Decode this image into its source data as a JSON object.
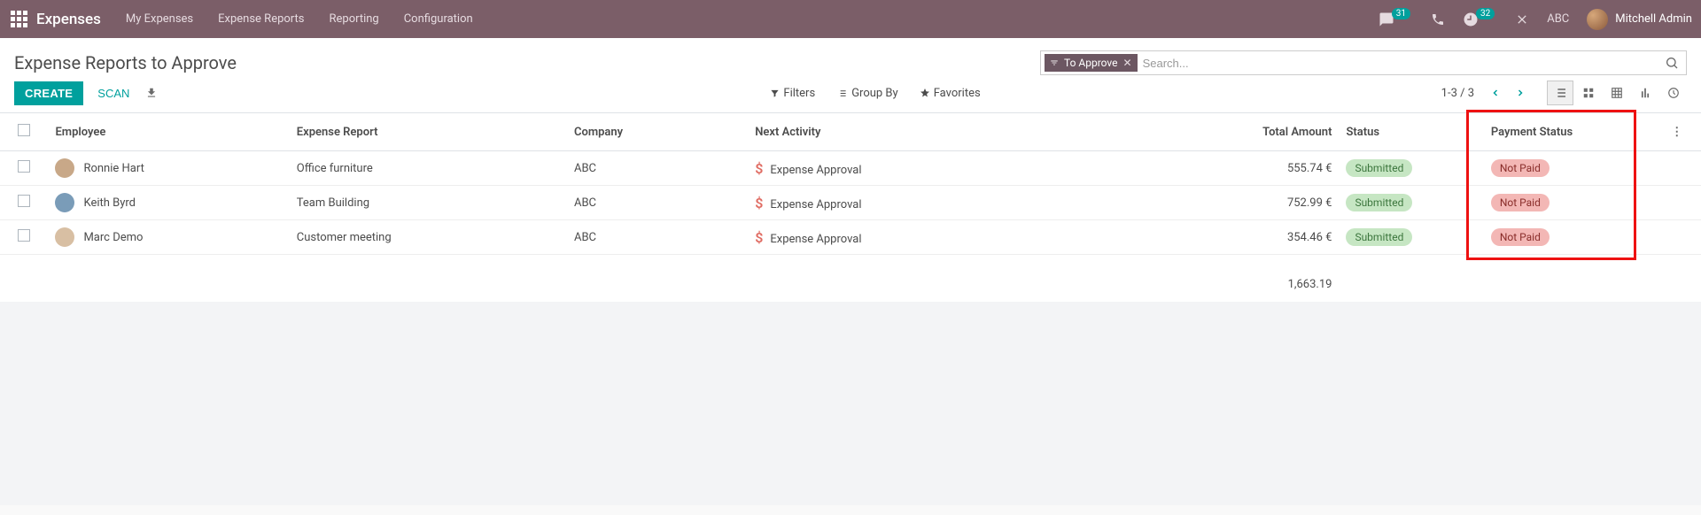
{
  "brand": "Expenses",
  "nav": [
    "My Expenses",
    "Expense Reports",
    "Reporting",
    "Configuration"
  ],
  "badges": {
    "chat": "31",
    "clock": "32"
  },
  "company": "ABC",
  "user": "Mitchell Admin",
  "page_title": "Expense Reports to Approve",
  "filter_chip": "To Approve",
  "search_placeholder": "Search...",
  "btn_create": "CREATE",
  "btn_scan": "SCAN",
  "toolbar": {
    "filters": "Filters",
    "groupby": "Group By",
    "favorites": "Favorites"
  },
  "pager": "1-3 / 3",
  "columns": {
    "employee": "Employee",
    "report": "Expense Report",
    "company": "Company",
    "activity": "Next Activity",
    "amount": "Total Amount",
    "status": "Status",
    "payment": "Payment Status"
  },
  "rows": [
    {
      "employee": "Ronnie Hart",
      "report": "Office furniture",
      "company": "ABC",
      "activity": "Expense Approval",
      "amount": "555.74 €",
      "status": "Submitted",
      "payment": "Not Paid"
    },
    {
      "employee": "Keith Byrd",
      "report": "Team Building",
      "company": "ABC",
      "activity": "Expense Approval",
      "amount": "752.99 €",
      "status": "Submitted",
      "payment": "Not Paid"
    },
    {
      "employee": "Marc Demo",
      "report": "Customer meeting",
      "company": "ABC",
      "activity": "Expense Approval",
      "amount": "354.46 €",
      "status": "Submitted",
      "payment": "Not Paid"
    }
  ],
  "total": "1,663.19"
}
